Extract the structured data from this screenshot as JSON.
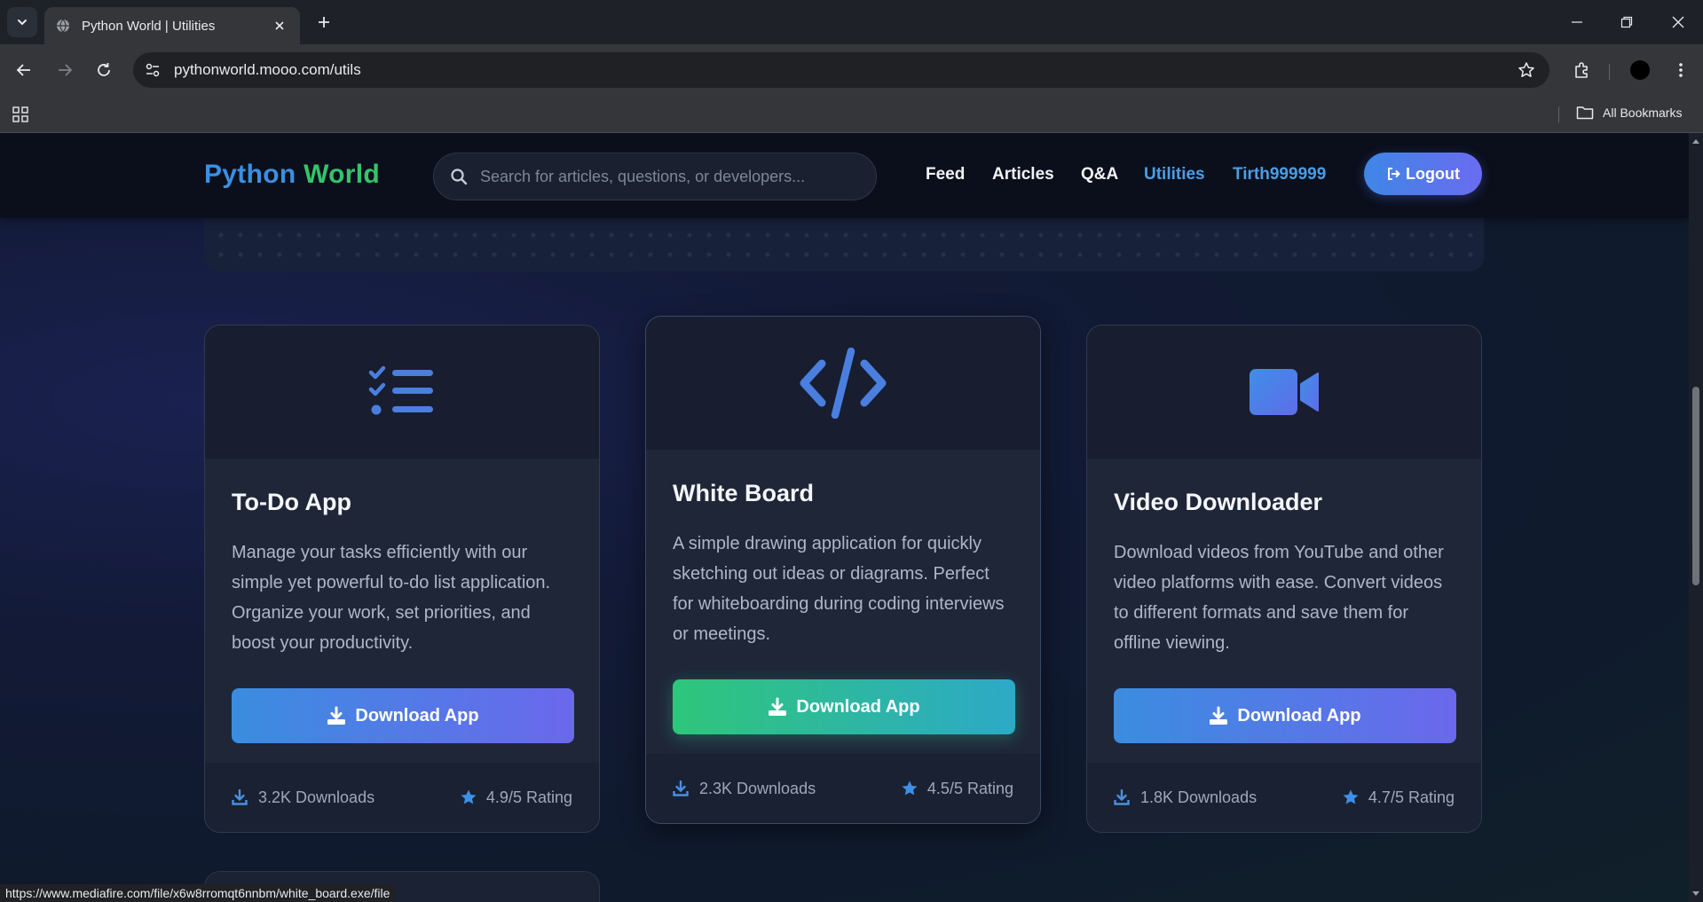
{
  "browser": {
    "tab_title": "Python World | Utilities",
    "url": "pythonworld.mooo.com/utils",
    "bookmarks_label": "All Bookmarks",
    "status_url": "https://www.mediafire.com/file/x6w8rromqt6nnbm/white_board.exe/file"
  },
  "site": {
    "logo_part1": "Python",
    "logo_part2": "World",
    "search_placeholder": "Search for articles, questions, or developers...",
    "nav": [
      "Feed",
      "Articles",
      "Q&A",
      "Utilities",
      "Tirth999999"
    ],
    "active_nav": "Utilities",
    "logout_label": "Logout",
    "colors": {
      "accent_blue": "#3b8fe0",
      "accent_green": "#34c46b",
      "header_bg": "#0b0f1c"
    }
  },
  "cards": [
    {
      "icon": "checklist-icon",
      "title": "To-Do App",
      "description": "Manage your tasks efficiently with our simple yet powerful to-do list application. Organize your work, set priorities, and boost your productivity.",
      "button_label": "Download App",
      "downloads": "3.2K Downloads",
      "rating": "4.9/5 Rating"
    },
    {
      "icon": "code-icon",
      "title": "White Board",
      "description": "A simple drawing application for quickly sketching out ideas or diagrams. Perfect for whiteboarding during coding interviews or meetings.",
      "button_label": "Download App",
      "downloads": "2.3K Downloads",
      "rating": "4.5/5 Rating"
    },
    {
      "icon": "video-camera-icon",
      "title": "Video Downloader",
      "description": "Download videos from YouTube and other video platforms with ease. Convert videos to different formats and save them for offline viewing.",
      "button_label": "Download App",
      "downloads": "1.8K Downloads",
      "rating": "4.7/5 Rating"
    }
  ]
}
